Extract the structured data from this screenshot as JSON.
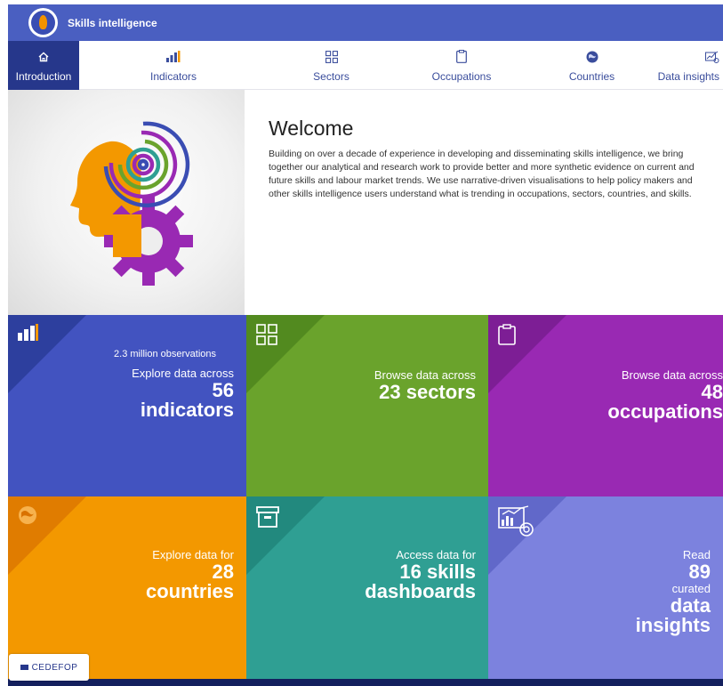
{
  "header": {
    "app_title": "Skills intelligence"
  },
  "nav": [
    {
      "label": "Introduction",
      "icon": "home-icon"
    },
    {
      "label": "Indicators",
      "icon": "bar-chart-icon"
    },
    {
      "label": "Sectors",
      "icon": "grid-icon"
    },
    {
      "label": "Occupations",
      "icon": "clipboard-icon"
    },
    {
      "label": "Countries",
      "icon": "globe-icon"
    },
    {
      "label": "Data insights",
      "icon": "chart-insights-icon"
    }
  ],
  "welcome": {
    "title": "Welcome",
    "body": "Building on over a decade of experience in developing and disseminating skills intelligence, we bring together our analytical and research work to provide better and more synthetic evidence on current and future skills and labour market trends. We use narrative-driven visualisations to help policy makers and other skills intelligence users understand what is trending in occupations, sectors, countries, and skills."
  },
  "tiles": {
    "indicators": {
      "observations": "2.3 million observations",
      "lead": "Explore data across",
      "number": "56",
      "noun": "indicators"
    },
    "sectors": {
      "lead": "Browse data across",
      "highlight": "23 sectors"
    },
    "occupations": {
      "lead": "Browse data across",
      "number": "48",
      "noun": "occupations"
    },
    "countries": {
      "lead": "Explore data for",
      "number": "28",
      "noun": "countries"
    },
    "dashboards": {
      "lead": "Access data for",
      "highlight1": "16 skills",
      "highlight2": "dashboards"
    },
    "insights": {
      "lead": "Read",
      "number": "89",
      "mid": "curated",
      "noun1": "data",
      "noun2": "insights"
    }
  },
  "footer": {
    "brand": "CEDEFOP"
  },
  "colors": {
    "header": "#4a5fc1",
    "nav_active": "#26378b",
    "indicators": "#4253c0",
    "sectors": "#6aa32c",
    "occupations": "#9929b3",
    "countries": "#f39800",
    "dashboards": "#2f9f93",
    "insights": "#7c82de"
  }
}
